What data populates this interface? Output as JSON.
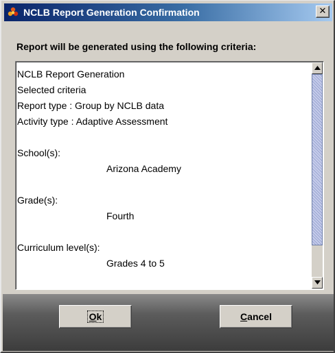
{
  "window": {
    "title": "NCLB Report Generation Confirmation",
    "title_icon": "app-logo-icon",
    "close_glyph": "✕"
  },
  "heading": "Report will be generated using the following criteria:",
  "report_lines": [
    "NCLB Report Generation",
    "Selected criteria",
    "Report type : Group by NCLB data",
    "Activity type : Adaptive Assessment",
    "",
    "School(s):",
    "Arizona Academy",
    "",
    "Grade(s):",
    "Fourth",
    "",
    "Curriculum level(s):",
    "Grades 4 to 5"
  ],
  "scrollbar": {
    "up_icon": "scroll-up-arrow-icon",
    "down_icon": "scroll-down-arrow-icon"
  },
  "buttons": {
    "ok": {
      "mnemonic": "O",
      "rest": "k"
    },
    "cancel": {
      "mnemonic": "C",
      "rest": "ancel"
    }
  },
  "colors": {
    "titlebar_start": "#0a246a",
    "titlebar_end": "#a6caf0",
    "dialog_bg": "#d4d0c8",
    "button_bar": "#5c5c5c",
    "scroll_thumb": "#c6ccea"
  }
}
